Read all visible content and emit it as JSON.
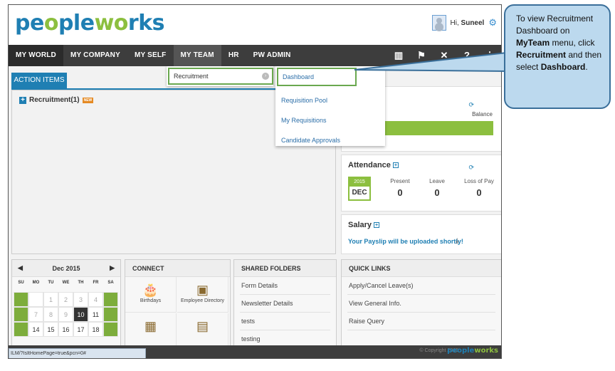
{
  "brand": {
    "logo_part1": "pe",
    "logo_part2": "o",
    "logo_part3": "ple",
    "logo_part4": "w",
    "logo_part5": "o",
    "logo_part6": "rks",
    "primary_color": "#1f7fb3",
    "accent_color": "#8cbf3f"
  },
  "header": {
    "greeting_prefix": "Hi,",
    "user_name": "Suneel"
  },
  "nav": {
    "items": [
      "MY WORLD",
      "MY COMPANY",
      "MY SELF",
      "MY TEAM",
      "HR",
      "PW ADMIN"
    ],
    "icons": [
      "book-icon",
      "pin-icon",
      "tools-icon",
      "help-icon",
      "sitemap-icon"
    ]
  },
  "menu": {
    "submenu_item": "Recruitment",
    "dashboard_items": [
      "Dashboard",
      "Requisition Pool",
      "My Requisitions",
      "Candidate Approvals"
    ]
  },
  "main": {
    "action_tab": "ACTION ITEMS",
    "recruitment_label": "Recruitment(1)",
    "new_badge": "NEW"
  },
  "leave": {
    "balance_label": "Balance"
  },
  "attendance": {
    "title": "Attendance",
    "year": "2015",
    "month": "DEC",
    "present_label": "Present",
    "present_value": "0",
    "leave_label": "Leave",
    "leave_value": "0",
    "lop_label": "Loss of Pay",
    "lop_value": "0"
  },
  "salary": {
    "title": "Salary",
    "payslip_text": "Your Payslip will be uploaded shortly!"
  },
  "calendar": {
    "month_label": "Dec 2015",
    "day_headers": [
      "SU",
      "MO",
      "TU",
      "WE",
      "TH",
      "FR",
      "SA"
    ],
    "days_row1": [
      "",
      "",
      "1",
      "2",
      "3",
      "4",
      ""
    ],
    "days_row2": [
      "",
      "7",
      "8",
      "9",
      "10",
      "11",
      ""
    ],
    "days_row3": [
      "",
      "14",
      "15",
      "16",
      "17",
      "18",
      ""
    ],
    "today": "10"
  },
  "connect": {
    "title": "CONNECT",
    "tiles": [
      "Birthdays",
      "Employee Directory"
    ]
  },
  "shared_folders": {
    "title": "SHARED FOLDERS",
    "items": [
      "Form Details",
      "Newsletter Details",
      "tests",
      "testing"
    ]
  },
  "quick_links": {
    "title": "QUICK LINKS",
    "items": [
      "Apply/Cancel Leave(s)",
      "View General Info.",
      "Raise Query"
    ]
  },
  "footer": {
    "status_url": "ILM/?IsItHomePage=true&pcn=0#",
    "copyright": "© Copyright 2015",
    "logo_text": "peopleworks"
  },
  "callout": {
    "line1": "To view Recruitment Dashboard on",
    "bold1": "MyTeam",
    "line2": "menu, click",
    "bold2": "Recruitment",
    "line3": "and then select",
    "bold3": "Dashboard",
    "line4": "."
  }
}
